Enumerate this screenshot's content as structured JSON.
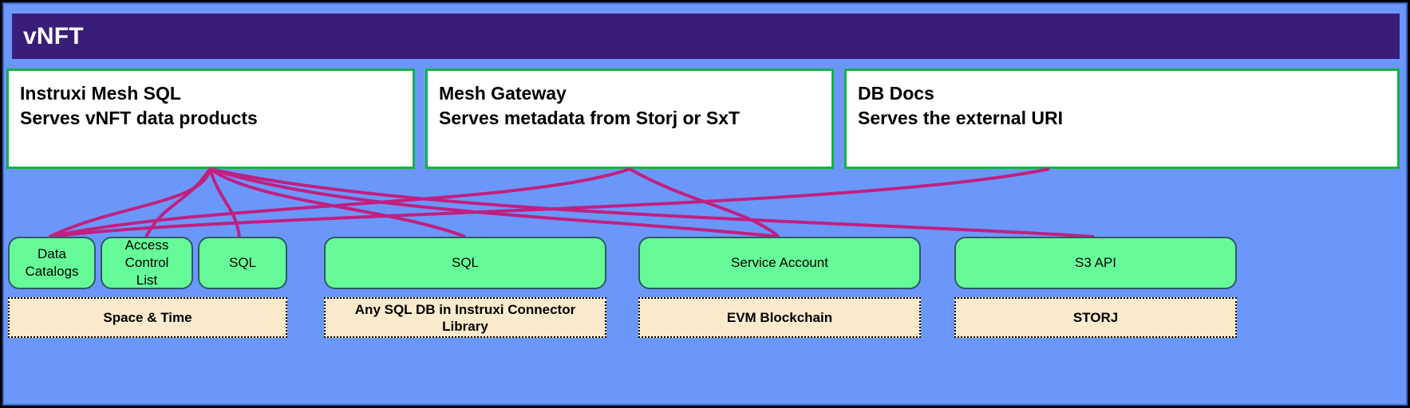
{
  "diagram": {
    "title": "vNFT",
    "colors": {
      "canvas_blue": "#6c97fa",
      "header_purple": "#381e78",
      "service_border_green": "#10b24b",
      "capability_green": "#66fb98",
      "store_tan": "#fbeacb",
      "connector_magenta": "#c02080"
    }
  },
  "services": [
    {
      "name": "instruxi-mesh-sql",
      "line1": "Instruxi Mesh SQL",
      "line2": "Serves vNFT data products"
    },
    {
      "name": "mesh-gateway",
      "line1": "Mesh Gateway",
      "line2": "Serves metadata from Storj or SxT"
    },
    {
      "name": "db-docs",
      "line1": "DB Docs",
      "line2": "Serves the external URI"
    }
  ],
  "capabilities": [
    {
      "name": "data-catalogs",
      "label": "Data\nCatalogs"
    },
    {
      "name": "access-control-list",
      "label": "Access\nControl\nList"
    },
    {
      "name": "sql-sxt",
      "label": "SQL"
    },
    {
      "name": "sql-connector",
      "label": "SQL"
    },
    {
      "name": "service-account",
      "label": "Service Account"
    },
    {
      "name": "s3-api",
      "label": "S3 API"
    }
  ],
  "stores": [
    {
      "name": "space-and-time",
      "label": "Space & Time"
    },
    {
      "name": "instruxi-connector-library",
      "label": "Any SQL DB in Instruxi Connector\nLibrary"
    },
    {
      "name": "evm-blockchain",
      "label": "EVM Blockchain"
    },
    {
      "name": "storj",
      "label": "STORJ"
    }
  ]
}
